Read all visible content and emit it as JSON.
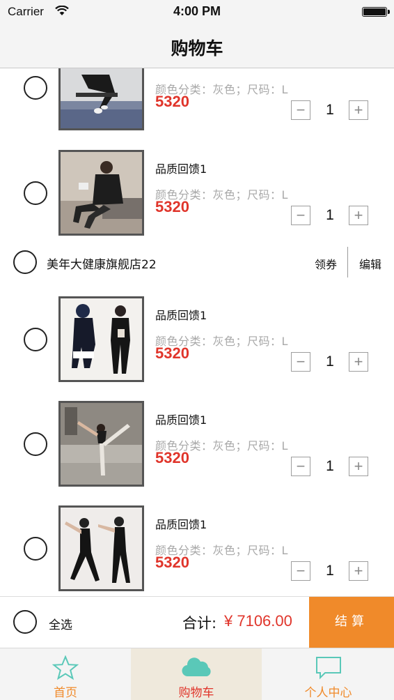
{
  "status_bar": {
    "carrier": "Carrier",
    "time": "4:00 PM"
  },
  "navbar": {
    "title": "购物车"
  },
  "items": [
    {
      "name": "",
      "spec": "颜色分类：灰色；尺码：L",
      "price": "5320",
      "qty": "1",
      "minus": "−",
      "plus": "+"
    },
    {
      "name": "品质回馈1",
      "spec": "颜色分类：灰色；尺码：L",
      "price": "5320",
      "qty": "1",
      "minus": "−",
      "plus": "+"
    },
    {
      "name": "品质回馈1",
      "spec": "颜色分类：灰色；尺码：L",
      "price": "5320",
      "qty": "1",
      "minus": "−",
      "plus": "+"
    },
    {
      "name": "品质回馈1",
      "spec": "颜色分类：灰色；尺码：L",
      "price": "5320",
      "qty": "1",
      "minus": "−",
      "plus": "+"
    },
    {
      "name": "品质回馈1",
      "spec": "颜色分类：灰色；尺码：L",
      "price": "5320",
      "qty": "1",
      "minus": "−",
      "plus": "+"
    }
  ],
  "store": {
    "name": "美年大健康旗舰店22",
    "coupon": "领券",
    "edit": "编辑"
  },
  "checkout": {
    "select_all": "全选",
    "total_label": "合计:",
    "total_value": "¥ 7106.00",
    "pay": "结算"
  },
  "tabs": [
    {
      "label": "首页",
      "icon": "star-icon"
    },
    {
      "label": "购物车",
      "icon": "cloud-icon"
    },
    {
      "label": "个人中心",
      "icon": "chat-bubble-icon"
    }
  ],
  "colors": {
    "accent": "#f08a2a",
    "price": "#e0352b",
    "tab_icon": "#5ac8b8"
  }
}
